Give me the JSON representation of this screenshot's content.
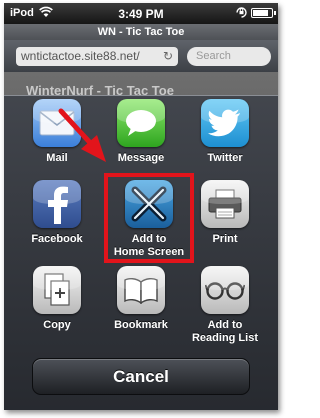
{
  "status_bar": {
    "carrier": "iPod",
    "time": "3:49 PM"
  },
  "browser": {
    "title": "WN - Tic Tac Toe",
    "url": "wntictactoe.site88.net/",
    "search_placeholder": "Search"
  },
  "page": {
    "title": "WinterNurf - Tic Tac Toe"
  },
  "share_sheet": {
    "items": [
      {
        "label": "Mail",
        "icon": "mail-icon"
      },
      {
        "label": "Message",
        "icon": "message-icon"
      },
      {
        "label": "Twitter",
        "icon": "twitter-icon"
      },
      {
        "label": "Facebook",
        "icon": "facebook-icon"
      },
      {
        "label": "Add to\nHome Screen",
        "icon": "add-to-home-screen-icon"
      },
      {
        "label": "Print",
        "icon": "printer-icon"
      },
      {
        "label": "Copy",
        "icon": "copy-icon"
      },
      {
        "label": "Bookmark",
        "icon": "book-icon"
      },
      {
        "label": "Add to\nReading List",
        "icon": "glasses-icon"
      }
    ],
    "cancel_label": "Cancel"
  },
  "colors": {
    "highlight": "#e2141b",
    "arrow": "#e2141b"
  }
}
